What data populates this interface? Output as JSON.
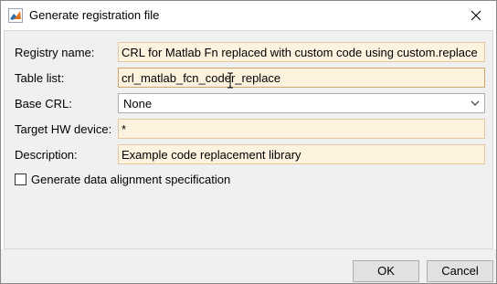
{
  "window": {
    "title": "Generate registration file",
    "icon": "matlab-app-icon",
    "close_icon": "close-icon"
  },
  "form": {
    "registry_name": {
      "label": "Registry name:",
      "value": "CRL for Matlab Fn replaced with custom code using custom.replace"
    },
    "table_list": {
      "label": "Table list:",
      "value": "crl_matlab_fcn_coder_replace"
    },
    "base_crl": {
      "label": "Base CRL:",
      "value": "None",
      "icon": "chevron-down-icon"
    },
    "target_hw": {
      "label": "Target HW device:",
      "value": "*"
    },
    "description": {
      "label": "Description:",
      "value": "Example code replacement library"
    },
    "alignment": {
      "label": "Generate data alignment specification",
      "checked": false
    }
  },
  "buttons": {
    "ok": "OK",
    "cancel": "Cancel"
  }
}
